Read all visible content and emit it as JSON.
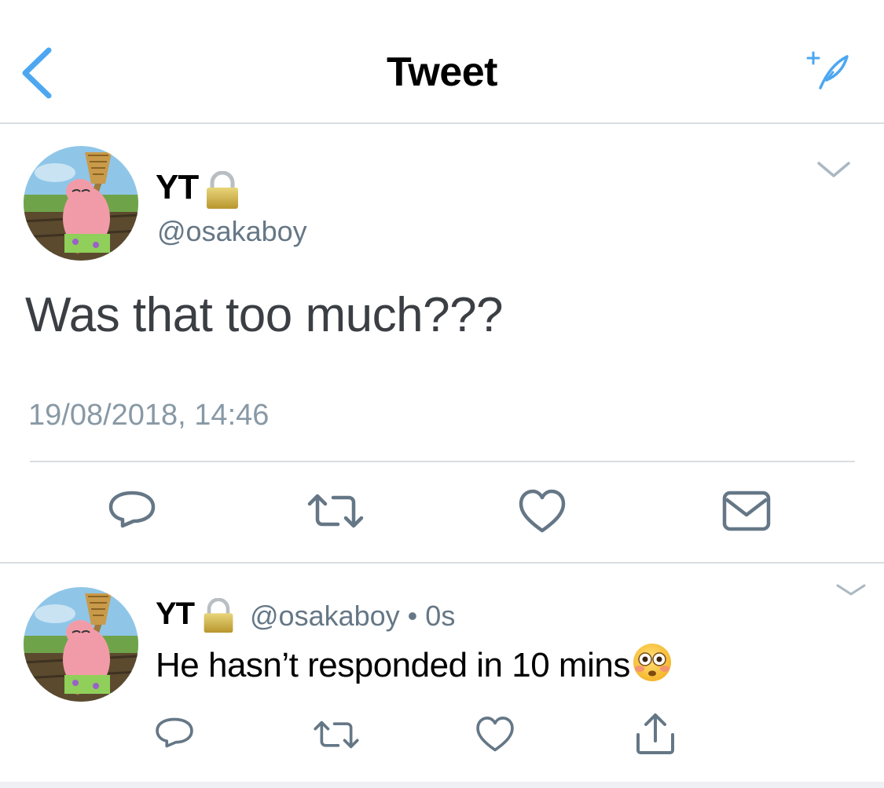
{
  "header": {
    "title": "Tweet",
    "back_icon": "chevron-left-icon",
    "compose_icon": "compose-feather-icon",
    "accent_color": "#4da7f0"
  },
  "main_tweet": {
    "display_name": "YT",
    "handle": "@osakaboy",
    "text": "Was that too much???",
    "timestamp": "19/08/2018, 14:46",
    "protected_icon": "lock-icon",
    "actions": [
      "reply-icon",
      "retweet-icon",
      "like-icon",
      "direct-message-icon"
    ]
  },
  "reply_tweet": {
    "display_name": "YT",
    "handle": "@osakaboy",
    "separator": "•",
    "age": "0s",
    "text": "He hasn’t responded in 10 mins",
    "emoji": "flushed-face-emoji",
    "protected_icon": "lock-icon",
    "actions": [
      "reply-icon",
      "retweet-icon",
      "like-icon",
      "share-icon"
    ]
  },
  "colors": {
    "icon_gray": "#657786",
    "divider": "#d8dde1",
    "timestamp": "#8899a6"
  }
}
